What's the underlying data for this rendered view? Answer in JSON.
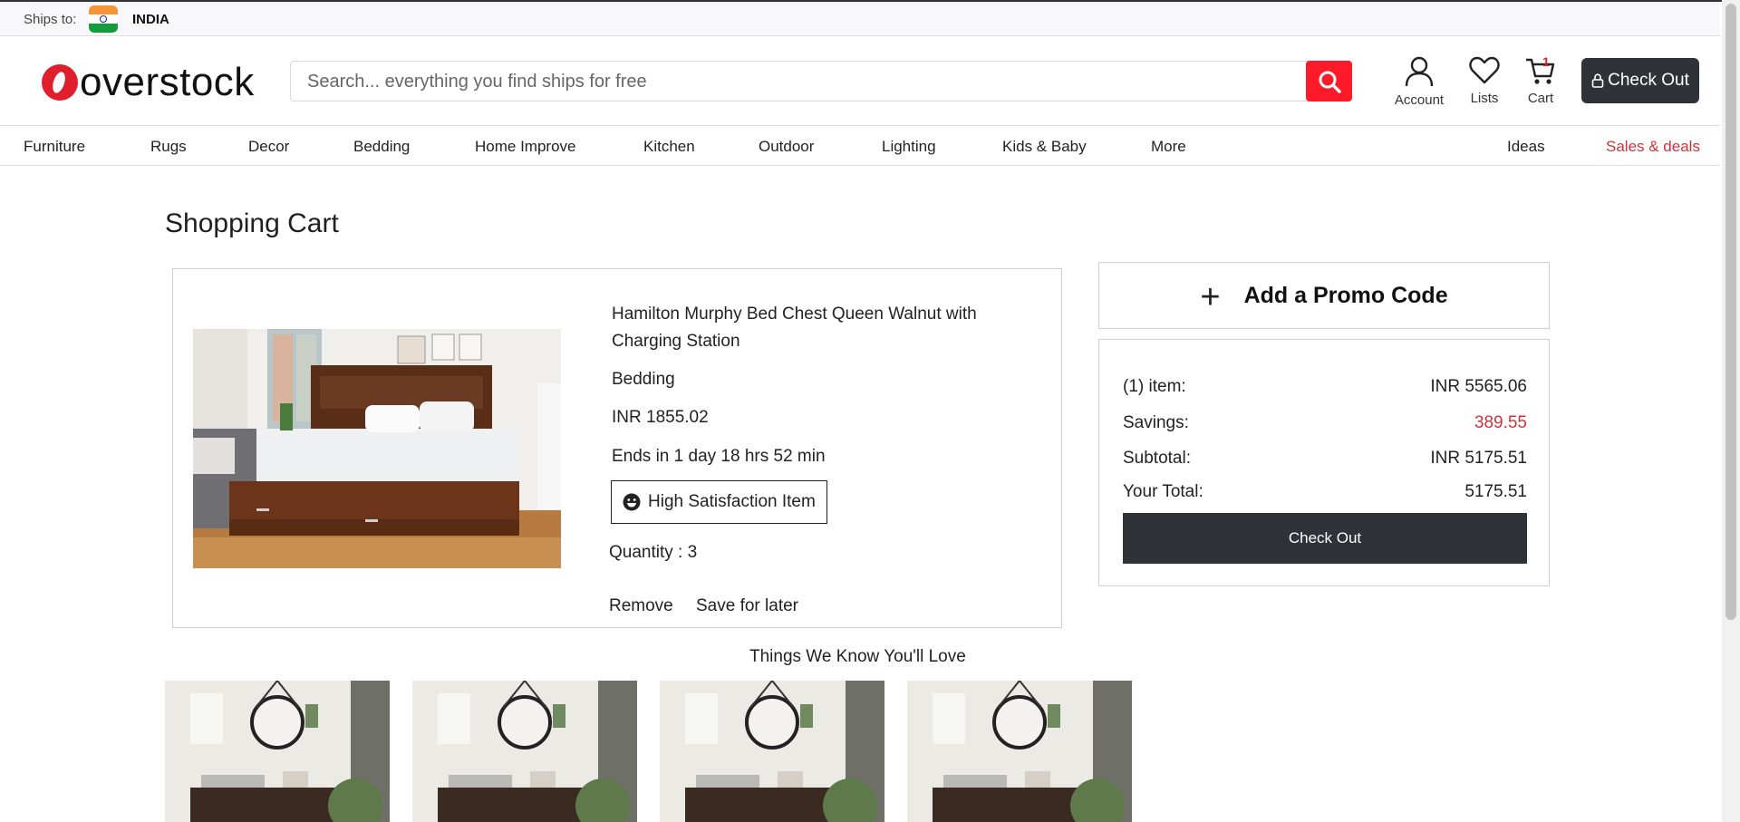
{
  "ship_bar": {
    "label": "Ships to:",
    "country": "INDIA"
  },
  "header": {
    "logo_text": "overstock",
    "search_placeholder": "Search... everything you find ships for free",
    "account_label": "Account",
    "lists_label": "Lists",
    "cart_label": "Cart",
    "cart_count": "1",
    "checkout_label": "Check Out"
  },
  "nav": {
    "items": [
      "Furniture",
      "Rugs",
      "Decor",
      "Bedding",
      "Home Improve",
      "Kitchen",
      "Outdoor",
      "Lighting",
      "Kids & Baby",
      "More"
    ],
    "ideas": "Ideas",
    "sales": "Sales & deals"
  },
  "cart": {
    "title": "Shopping Cart",
    "item": {
      "name": "Hamilton Murphy Bed Chest Queen Walnut with Charging Station",
      "category": "Bedding",
      "price": "INR 1855.02",
      "ends": "Ends in 1 day 18 hrs 52 min",
      "badge": "High Satisfaction Item",
      "quantity": "Quantity : 3",
      "remove": "Remove",
      "save_for_later": "Save for later"
    }
  },
  "promo": {
    "label": "Add a Promo Code",
    "plus": "+"
  },
  "summary": {
    "items_label": "(1) item:",
    "items_value": "INR 5565.06",
    "savings_label": "Savings:",
    "savings_value": "389.55",
    "subtotal_label": "Subtotal:",
    "subtotal_value": "INR 5175.51",
    "total_label": "Your Total:",
    "total_value": "5175.51",
    "checkout_label": "Check Out"
  },
  "recommendations": {
    "title": "Things We Know You'll Love"
  },
  "colors": {
    "brand_red": "#e01f2d",
    "dark": "#2f3337",
    "sale_red": "#d13239"
  }
}
